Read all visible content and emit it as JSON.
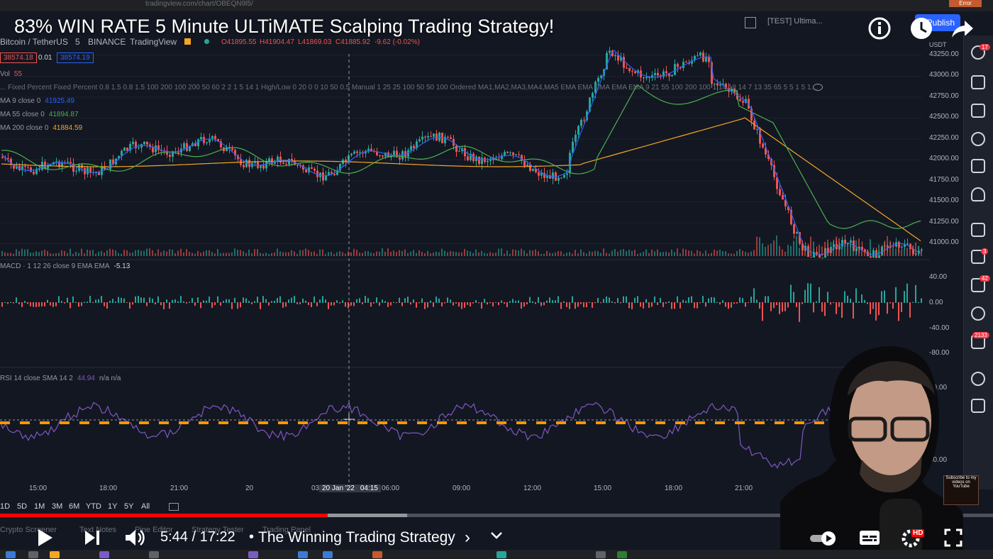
{
  "browser": {
    "url": "tradingview.com/chart/OBEQN9l5/"
  },
  "video": {
    "title": "83% WIN RATE 5 Minute ULTiMATE Scalping Trading Strategy!",
    "time_current": "5:44",
    "time_total": "17:22",
    "time_display": "5:44 / 17:22",
    "separator": "•",
    "chapter": "The Winning Trading Strategy",
    "chapter_arrow": "›",
    "progress_fraction": 0.33,
    "buffered_fraction": 0.41,
    "hd_badge": "HD",
    "icons": [
      "info-icon",
      "watch-later-icon",
      "share-icon",
      "play-icon",
      "next-icon",
      "volume-icon",
      "chevron-down-icon",
      "autoplay-toggle-icon",
      "subtitles-icon",
      "settings-icon",
      "fullscreen-icon"
    ]
  },
  "tv_header": {
    "layout_name": "[TEST] Ultima...",
    "publish": "Publish",
    "error_badge": "Error"
  },
  "symbol": {
    "name": "Bitcoin / TetherUS",
    "interval": "5",
    "exchange": "BINANCE",
    "source": "TradingView",
    "ohlc": {
      "o": "O41895.55",
      "h": "H41904.47",
      "l": "L41869.03",
      "c": "C41885.92",
      "chg": "-9.62 (-0.02%)"
    },
    "bid": "38574.18",
    "spread": "0.01",
    "ask": "38574.19"
  },
  "indicators": {
    "vol": {
      "label": "Vol",
      "value": "55"
    },
    "strategy": "... Fixed Percent Fixed Percent 0.8 1.5 0.8 1.5 100 200 100 200 50 60 2 2 1 5 14 1 High/Low 0 20 0 0 10 50 0.5 Manual 1 25 25 100 50 50 100 Ordered MA1,MA2,MA3,MA4,MA5 EMA EMA EMA EMA EMA 9 21 55 100 200 100 1 14 18 14 7 13 35 65 5 5 1 5 1...",
    "ma9": {
      "label": "MA 9 close 0",
      "value": "41925.49"
    },
    "ma55": {
      "label": "MA 55 close 0",
      "value": "41894.87"
    },
    "ma200": {
      "label": "MA 200 close 0",
      "value": "41884.59"
    },
    "macd": {
      "label": "MACD · 1 12 26 close 9 EMA EMA",
      "value": "-5.13"
    },
    "rsi": {
      "label": "RSI 14 close SMA 14 2",
      "value": "44.94",
      "extra": "n/a n/a"
    }
  },
  "price_axis": {
    "currency": "USDT",
    "ticks": [
      "43250.00",
      "43000.00",
      "42750.00",
      "42500.00",
      "42250.00",
      "42000.00",
      "41750.00",
      "41500.00",
      "41250.00",
      "41000.00"
    ]
  },
  "macd_axis": {
    "ticks": [
      "40.00",
      "0.00",
      "-40.00",
      "-80.00"
    ]
  },
  "rsi_axis": {
    "ticks": [
      "70.00",
      "30.00"
    ]
  },
  "time_axis": {
    "ticks": [
      "15:00",
      "18:00",
      "21:00",
      "20",
      "03",
      "06:00",
      "09:00",
      "12:00",
      "15:00",
      "18:00",
      "21:00"
    ],
    "cursor_date": "20 Jan '22",
    "cursor_time": "04:15"
  },
  "timeframes": [
    "1D",
    "5D",
    "1M",
    "3M",
    "6M",
    "YTD",
    "1Y",
    "5Y",
    "All"
  ],
  "bottom_tabs": [
    "Crypto Screener",
    "Text Notes",
    "Pine Editor",
    "Strategy Tester",
    "Trading Panel"
  ],
  "right_badges": {
    "alerts": "17",
    "chats": "3",
    "ideas": "42",
    "notifications": "2133"
  },
  "subscribe_badge": "Subscribe to my videos on YouTube",
  "colors": {
    "up": "#26a69a",
    "down": "#ef5350",
    "ma9": "#2962ff",
    "ma55": "#4caf50",
    "ma200": "#f5a623",
    "rsi": "#7e57c2",
    "rsi_band": "#ff9800",
    "bg": "#131722"
  }
}
